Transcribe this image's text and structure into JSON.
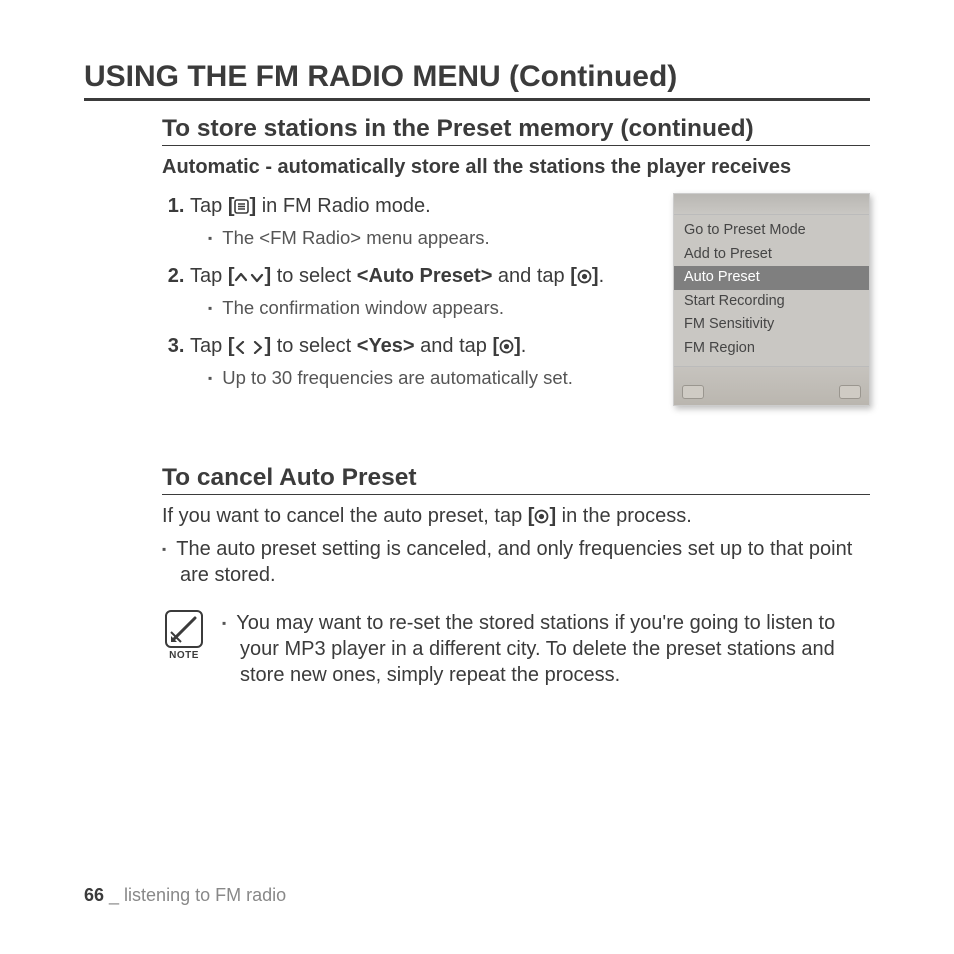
{
  "page_title": "USING THE FM RADIO MENU (Continued)",
  "section1": {
    "heading": "To store stations in the Preset memory (continued)",
    "subheading": "Automatic - automatically store all the stations the player receives",
    "steps": [
      {
        "pre": "Tap ",
        "icon": "menu",
        "post": " in FM Radio mode.",
        "bullet": "The <FM Radio> menu appears."
      },
      {
        "pre": "Tap ",
        "icon": "updown",
        "mid": " to select ",
        "bold": "<Auto Preset>",
        "mid2": " and tap ",
        "icon2": "target",
        "post": ".",
        "bullet": "The confirmation window appears."
      },
      {
        "pre": "Tap ",
        "icon": "leftright",
        "mid": " to select ",
        "bold": "<Yes>",
        "mid2": " and tap ",
        "icon2": "target",
        "post": ".",
        "bullet": "Up to 30 frequencies are automatically set."
      }
    ],
    "device_menu": {
      "items": [
        "Go to Preset Mode",
        "Add to Preset",
        "Auto Preset",
        "Start Recording",
        "FM Sensitivity",
        "FM Region"
      ],
      "selected_index": 2
    }
  },
  "section2": {
    "heading": "To cancel Auto Preset",
    "lead_pre": "If you want to cancel the auto preset, tap ",
    "lead_icon": "target",
    "lead_post": " in the process.",
    "bullet": "The auto preset setting is canceled, and only frequencies set up to that point are stored.",
    "note_label": "NOTE",
    "note_text": "You may want to re-set the stored stations if you're going to listen to your MP3 player in a different city. To delete the preset stations and store new ones, simply repeat the process."
  },
  "footer": {
    "page_no": "66",
    "sep": " _ ",
    "chapter": "listening to FM radio"
  }
}
